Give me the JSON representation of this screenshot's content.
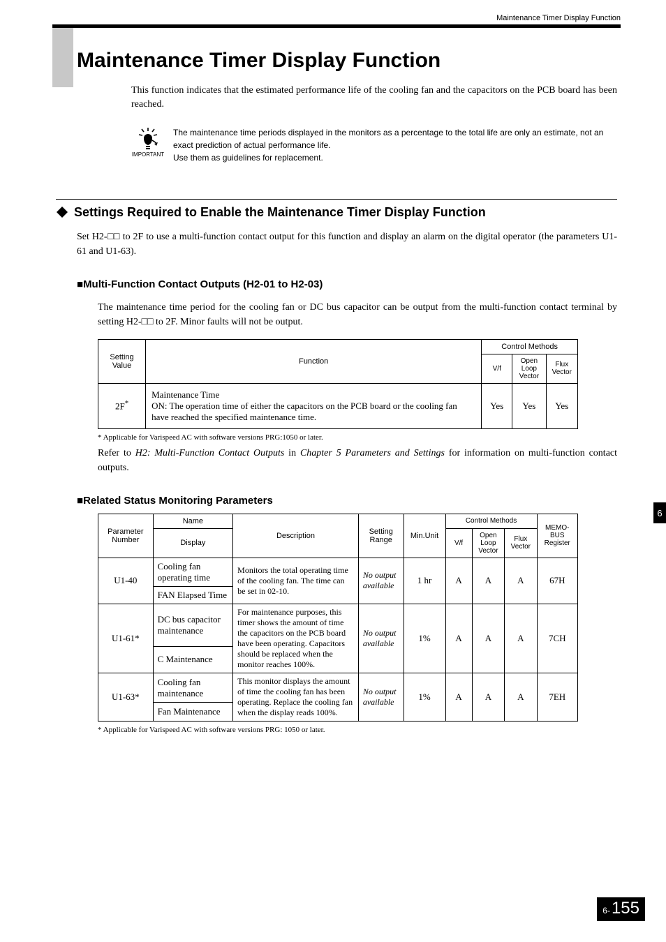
{
  "runningHeader": "Maintenance Timer Display Function",
  "title": "Maintenance Timer Display Function",
  "intro": "This function indicates that the estimated performance life of the cooling fan and the capacitors on the PCB board has been reached.",
  "important": {
    "label": "IMPORTANT",
    "line1": "The maintenance time periods displayed in the monitors as a percentage to the total life are only an estimate, not an exact prediction of actual performance life.",
    "line2": "Use them as guidelines for replacement."
  },
  "section": {
    "heading": "Settings Required to Enable the Maintenance Timer Display Function",
    "body": "Set H2-□□ to 2F to use a multi-function contact output for this function and display an alarm on the digital operator (the parameters U1-61 and U1-63)."
  },
  "sub1": {
    "heading": "Multi-Function Contact Outputs (H2-01 to H2-03)",
    "body": "The maintenance time period for the cooling fan or DC bus capacitor can be output from the multi-function contact terminal by setting H2-□□ to 2F. Minor faults will not be output."
  },
  "table1": {
    "headers": {
      "settingValue": "Setting Value",
      "function": "Function",
      "controlMethods": "Control Methods",
      "vf": "V/f",
      "olv": "Open Loop Vector",
      "fv": "Flux Vector"
    },
    "row": {
      "value": "2F",
      "sup": "*",
      "func": "Maintenance Time\nON: The operation time of either the capacitors on the PCB board or the cooling fan have reached the specified maintenance time.",
      "vf": "Yes",
      "olv": "Yes",
      "fv": "Yes"
    }
  },
  "footnote1": "*   Applicable for Varispeed AC with software versions PRG:1050 or later.",
  "refer": {
    "pre": "Refer to ",
    "it1": "H2: Multi-Function Contact Outputs",
    "mid": " in ",
    "it2": "Chapter 5 Parameters and Settings",
    "post": " for information on multi-function contact outputs."
  },
  "sub2": {
    "heading": "Related Status Monitoring Parameters"
  },
  "table2": {
    "headers": {
      "param": "Parameter Number",
      "name": "Name",
      "display": "Display",
      "desc": "Description",
      "range": "Setting Range",
      "unit": "Min.Unit",
      "cm": "Control Methods",
      "vf": "V/f",
      "olv": "Open Loop Vector",
      "fv": "Flux Vector",
      "memo": "MEMO-BUS Register"
    },
    "rows": [
      {
        "param": "U1-40",
        "name": "Cooling fan operating time",
        "display": "FAN Elapsed Time",
        "desc": "Monitors the total operating time of the cooling fan. The time can be set in 02-10.",
        "range": "No output available",
        "unit": "1 hr",
        "vf": "A",
        "olv": "A",
        "fv": "A",
        "memo": "67H"
      },
      {
        "param": "U1-61*",
        "name": "DC bus capacitor maintenance",
        "display": "C Maintenance",
        "desc": "For maintenance purposes, this timer shows the amount of time the capacitors on the PCB board have been operating. Capacitors should be replaced when the monitor reaches 100%.",
        "range": "No output available",
        "unit": "1%",
        "vf": "A",
        "olv": "A",
        "fv": "A",
        "memo": "7CH"
      },
      {
        "param": "U1-63*",
        "name": "Cooling fan maintenance",
        "display": "Fan Maintenance",
        "desc": "This monitor displays the amount of time the cooling fan has been operating. Replace the cooling fan when the display reads 100%.",
        "range": "No output available",
        "unit": "1%",
        "vf": "A",
        "olv": "A",
        "fv": "A",
        "memo": "7EH"
      }
    ]
  },
  "footnote2": "*   Applicable for Varispeed AC with software versions PRG: 1050 or later.",
  "sideTab": "6",
  "pageNum": {
    "prefix": "6-",
    "num": "155"
  }
}
